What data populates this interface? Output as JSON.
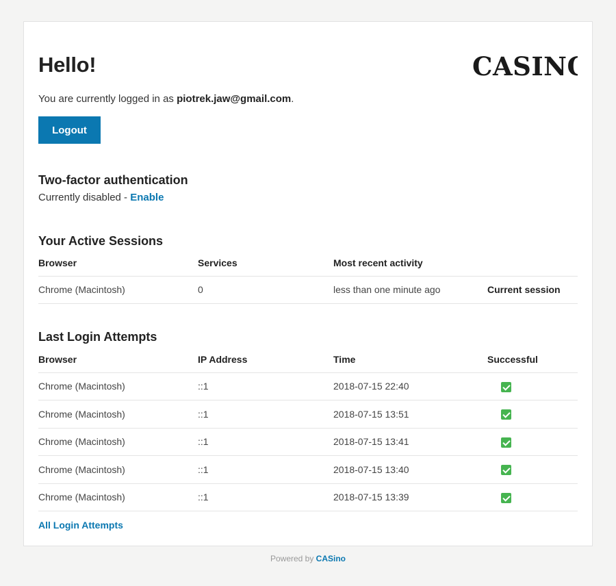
{
  "header": {
    "greeting": "Hello!",
    "logo_text": "CASINO"
  },
  "account": {
    "logged_in_prefix": "You are currently logged in as ",
    "email": "piotrek.jaw@gmail.com",
    "logged_in_suffix": ".",
    "logout_label": "Logout"
  },
  "two_factor": {
    "title": "Two-factor authentication",
    "status": "Currently disabled - ",
    "enable_label": "Enable"
  },
  "sessions": {
    "title": "Your Active Sessions",
    "columns": [
      "Browser",
      "Services",
      "Most recent activity",
      ""
    ],
    "rows": [
      {
        "browser": "Chrome (Macintosh)",
        "services": "0",
        "activity": "less than one minute ago",
        "note": "Current session"
      }
    ]
  },
  "login_attempts": {
    "title": "Last Login Attempts",
    "columns": [
      "Browser",
      "IP Address",
      "Time",
      "Successful"
    ],
    "rows": [
      {
        "browser": "Chrome (Macintosh)",
        "ip": "::1",
        "time": "2018-07-15 22:40",
        "successful": true
      },
      {
        "browser": "Chrome (Macintosh)",
        "ip": "::1",
        "time": "2018-07-15 13:51",
        "successful": true
      },
      {
        "browser": "Chrome (Macintosh)",
        "ip": "::1",
        "time": "2018-07-15 13:41",
        "successful": true
      },
      {
        "browser": "Chrome (Macintosh)",
        "ip": "::1",
        "time": "2018-07-15 13:40",
        "successful": true
      },
      {
        "browser": "Chrome (Macintosh)",
        "ip": "::1",
        "time": "2018-07-15 13:39",
        "successful": true
      }
    ],
    "all_link_label": "All Login Attempts"
  },
  "footer": {
    "powered_by": "Powered by ",
    "brand": "CASino"
  },
  "colors": {
    "accent": "#0b78b1",
    "success": "#46b450",
    "background": "#f4f4f3"
  }
}
